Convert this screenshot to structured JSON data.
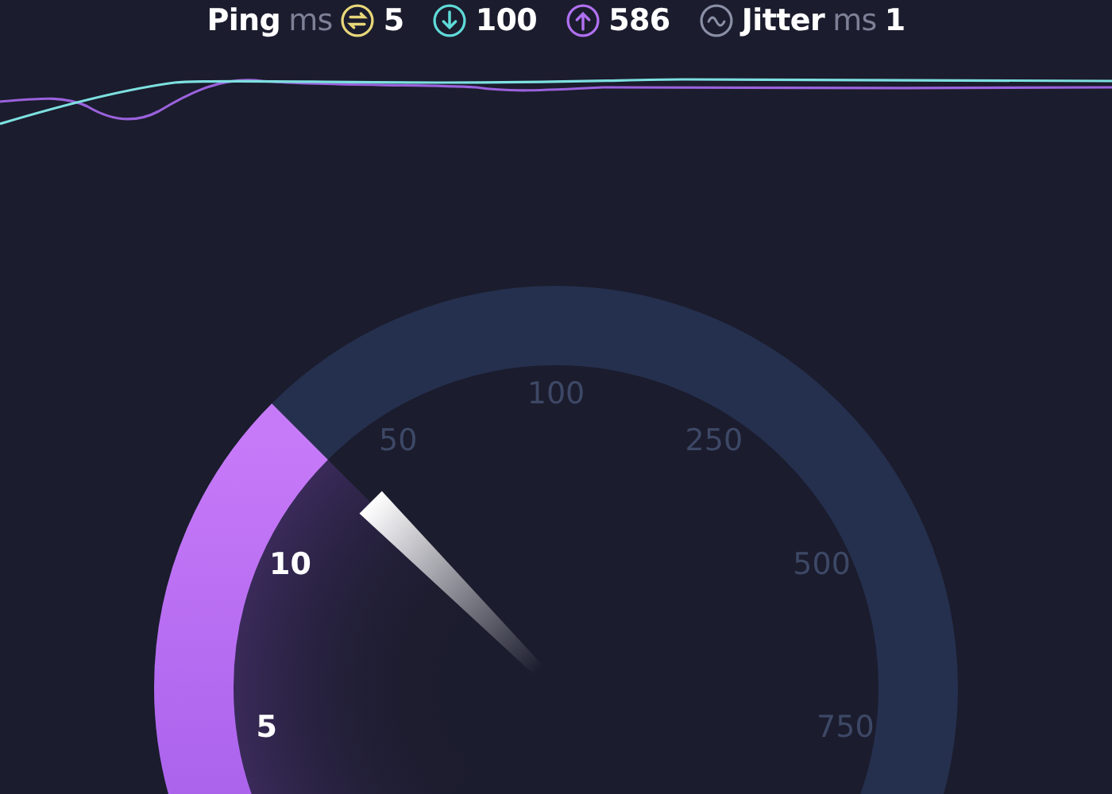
{
  "stats": {
    "ping": {
      "label": "Ping",
      "unit": "ms",
      "value": "5"
    },
    "download": {
      "value": "100"
    },
    "upload": {
      "value": "586"
    },
    "jitter": {
      "label": "Jitter",
      "unit": "ms",
      "value": "1"
    }
  },
  "gauge": {
    "labels": [
      "5",
      "10",
      "50",
      "100",
      "250",
      "500",
      "750"
    ]
  }
}
